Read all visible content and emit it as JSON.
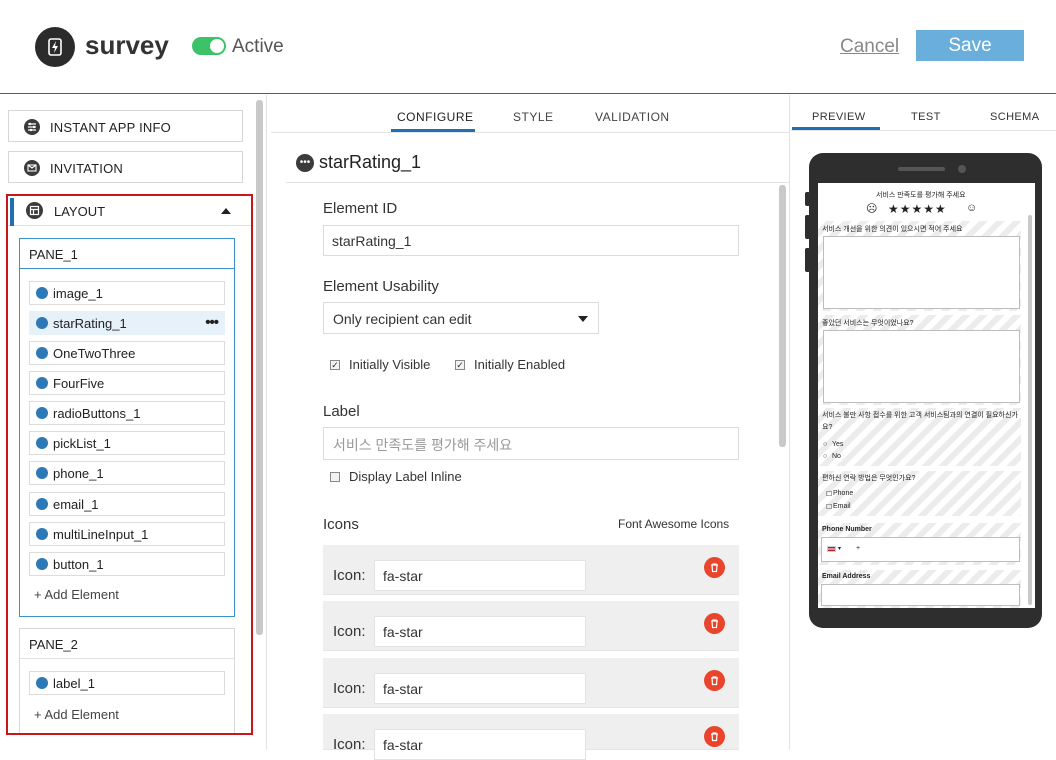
{
  "header": {
    "app_name": "survey",
    "status": "Active",
    "cancel_label": "Cancel",
    "save_label": "Save"
  },
  "left": {
    "sections": [
      {
        "label": "INSTANT APP INFO",
        "icon": "sliders-icon"
      },
      {
        "label": "INVITATION",
        "icon": "envelope-icon"
      }
    ],
    "layout_label": "LAYOUT",
    "panes": [
      {
        "title": "PANE_1",
        "elements": [
          {
            "label": "image_1",
            "icon": "image-icon"
          },
          {
            "label": "starRating_1",
            "icon": "ellipsis-icon",
            "selected": true,
            "more": "•••"
          },
          {
            "label": "OneTwoThree",
            "icon": "list-icon"
          },
          {
            "label": "FourFive",
            "icon": "list-icon"
          },
          {
            "label": "radioButtons_1",
            "icon": "radio-icon"
          },
          {
            "label": "pickList_1",
            "icon": "list-icon"
          },
          {
            "label": "phone_1",
            "icon": "phone-icon"
          },
          {
            "label": "email_1",
            "icon": "envelope-icon"
          },
          {
            "label": "multiLineInput_1",
            "icon": "list-icon"
          },
          {
            "label": "button_1",
            "icon": "button-icon"
          }
        ],
        "add_label": "+ Add Element"
      },
      {
        "title": "PANE_2",
        "elements": [
          {
            "label": "label_1",
            "icon": "label-icon"
          }
        ],
        "add_label": "+ Add Element"
      }
    ]
  },
  "middle": {
    "tabs": [
      "CONFIGURE",
      "STYLE",
      "VALIDATION"
    ],
    "active_tab": "CONFIGURE",
    "element_title": "starRating_1",
    "title_icon_glyph": "•••",
    "element_id_label": "Element ID",
    "element_id_value": "starRating_1",
    "usability_label": "Element Usability",
    "usability_value": "Only recipient can edit",
    "initially_visible_label": "Initially Visible",
    "initially_visible": true,
    "initially_enabled_label": "Initially Enabled",
    "initially_enabled": true,
    "label_label": "Label",
    "label_placeholder": "서비스 만족도를 평가해 주세요",
    "display_inline_label": "Display Label Inline",
    "display_inline": false,
    "icons_label": "Icons",
    "icons_link": "Font Awesome Icons",
    "icon_field_label": "Icon:",
    "icon_values": [
      "fa-star",
      "fa-star",
      "fa-star",
      "fa-star"
    ]
  },
  "right": {
    "tabs": [
      "PREVIEW",
      "TEST",
      "SCHEMA"
    ],
    "active_tab": "PREVIEW",
    "preview": {
      "rating_title": "서비스 만족도를 평가해 주세요",
      "frown_glyph": "☹",
      "stars": "★★★★★",
      "smile_glyph": "☺",
      "q1": "서비스 개선을 위한 의견이 있으시면 적어 주세요",
      "q2": "좋았던 서비스는 무엇이었나요?",
      "q3": "서비스 불만 사항 접수를 위한 고객 서비스팀과의 연결이 필요하신가요?",
      "yes": "Yes",
      "no": "No",
      "q4": "편하신 연락 방법은 무엇인가요?",
      "opt_phone": "Phone",
      "opt_email": "Email",
      "phone_label": "Phone Number",
      "phone_prefix": "+",
      "email_label": "Email Address"
    }
  },
  "colors": {
    "accent": "#1f6fb1",
    "save_button": "#6aaedc",
    "toggle_on": "#3cc36a",
    "highlight_border": "#c9151b",
    "delete": "#e8452c"
  }
}
